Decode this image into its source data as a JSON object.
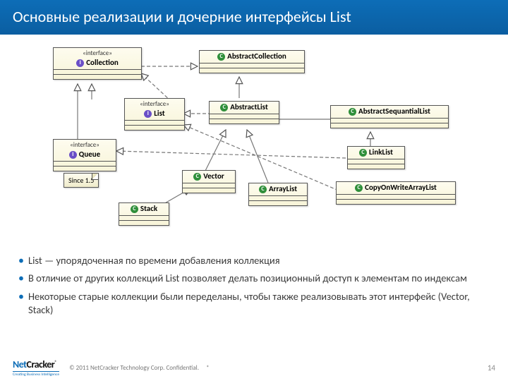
{
  "header": {
    "title": "Основные реализации и дочерние интерфейсы List"
  },
  "uml": {
    "collection": {
      "stereo": "«interface»",
      "name": "Collection",
      "kind": "iface"
    },
    "list": {
      "stereo": "«interface»",
      "name": "List",
      "kind": "iface"
    },
    "queue": {
      "stereo": "«interface»",
      "name": "Queue",
      "kind": "iface"
    },
    "note_since": {
      "text": "Since 1.5"
    },
    "stack": {
      "name": "Stack",
      "kind": "cls"
    },
    "abscoll": {
      "name": "AbstractCollection",
      "kind": "cls"
    },
    "abslist": {
      "name": "AbstractList",
      "kind": "cls"
    },
    "vector": {
      "name": "Vector",
      "kind": "cls"
    },
    "arraylist": {
      "name": "ArrayList",
      "kind": "cls"
    },
    "absseq": {
      "name": "AbstractSequantialList",
      "kind": "cls"
    },
    "linklist": {
      "name": "LinkList",
      "kind": "cls"
    },
    "cowal": {
      "name": "CopyOnWriteArrayList",
      "kind": "cls"
    }
  },
  "bullets": {
    "b1": "List — упорядоченная по времени добавления коллекция",
    "b2": "В отличие от других коллекций List позволяет делать позиционный доступ к элементам по индексам",
    "b3": "Некоторые старые коллекции были переделаны, чтобы также реализовывать этот интерфейс  (Vector, Stack)"
  },
  "footer": {
    "logo_net": "Net",
    "logo_cracker": "Cracker",
    "logo_reg": "®",
    "logo_sub": "Creating Business Intelligence",
    "copyright": "© 2011 NetCracker Technology Corp. Confidential.",
    "asterisk": "*",
    "page": "14"
  }
}
